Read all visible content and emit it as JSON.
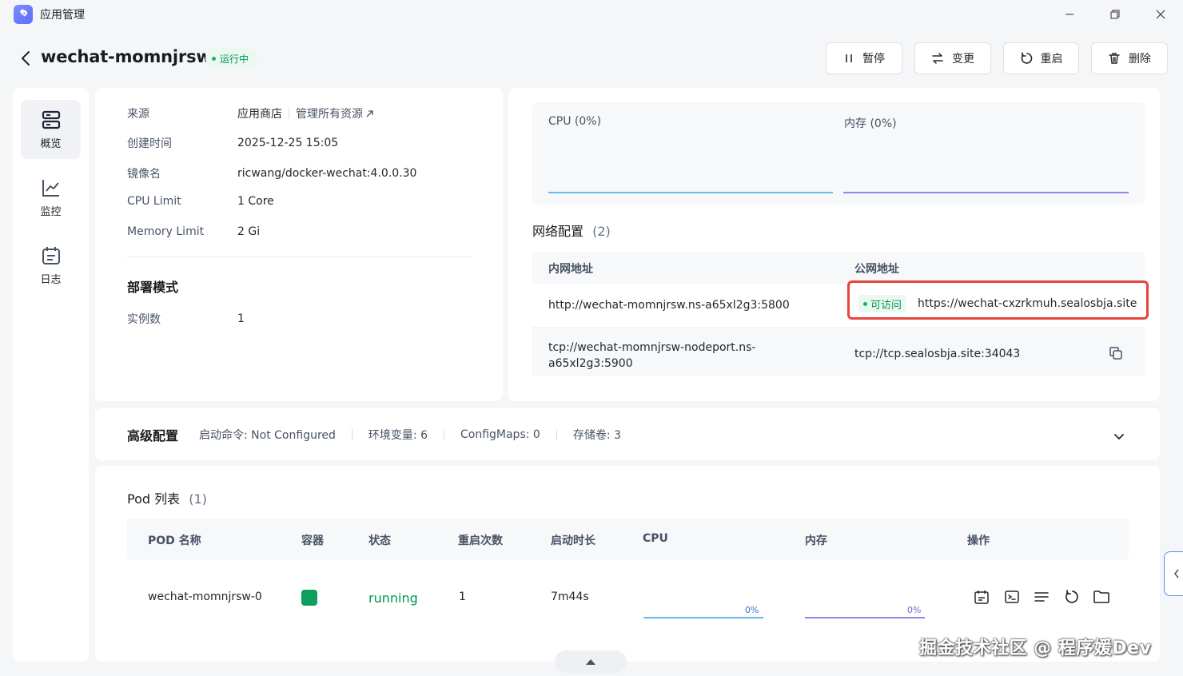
{
  "window": {
    "title": "应用管理"
  },
  "header": {
    "app_name": "wechat-momnjrsw",
    "status": "运行中",
    "actions": {
      "pause": "暂停",
      "change": "变更",
      "restart": "重启",
      "delete": "删除"
    }
  },
  "sidebar": {
    "items": [
      {
        "label": "概览",
        "icon": "server-icon"
      },
      {
        "label": "监控",
        "icon": "chart-line-icon"
      },
      {
        "label": "日志",
        "icon": "calendar-log-icon"
      }
    ]
  },
  "info": {
    "source_label": "来源",
    "source_value": "应用商店",
    "source_link": "管理所有资源",
    "created_label": "创建时间",
    "created_value": "2025-12-25 15:05",
    "image_label": "镜像名",
    "image_value": "ricwang/docker-wechat:4.0.0.30",
    "cpu_label": "CPU Limit",
    "cpu_value": "1 Core",
    "mem_label": "Memory Limit",
    "mem_value": "2 Gi",
    "deploy_title": "部署模式",
    "replicas_label": "实例数",
    "replicas_value": "1"
  },
  "monitor": {
    "cpu": "CPU  (0%)",
    "mem": "内存  (0%)",
    "cpu_color": "#6ab7e8",
    "mem_color": "#8f87e8"
  },
  "network": {
    "title": "网络配置",
    "count": "(2)",
    "col_private": "内网地址",
    "col_public": "公网地址",
    "rows": [
      {
        "private": "http://wechat-momnjrsw.ns-a65xl2g3:5800",
        "access": "可访问",
        "public": "https://wechat-cxzrkmuh.sealosbja.site"
      },
      {
        "private_line1": "tcp://wechat-momnjrsw-nodeport.ns-",
        "private_line2": "a65xl2g3:5900",
        "public": "tcp://tcp.sealosbja.site:34043"
      }
    ]
  },
  "advanced": {
    "title": "高级配置",
    "command": "启动命令: Not Configured",
    "env": "环境变量: 6",
    "configmaps": "ConfigMaps: 0",
    "storage": "存储卷: 3"
  },
  "pods": {
    "title": "Pod 列表",
    "count": "(1)",
    "columns": [
      "POD 名称",
      "容器",
      "状态",
      "重启次数",
      "启动时长",
      "CPU",
      "内存",
      "操作"
    ],
    "rows": [
      {
        "name": "wechat-momnjrsw-0",
        "status": "running",
        "restarts": "1",
        "uptime": "7m44s",
        "cpu": "0%",
        "mem": "0%"
      }
    ]
  },
  "watermark": "掘金技术社区 @ 程序媛Dev",
  "colors": {
    "running": "#039855",
    "container": "#0e9f5c",
    "highlight": "#e5453d"
  }
}
